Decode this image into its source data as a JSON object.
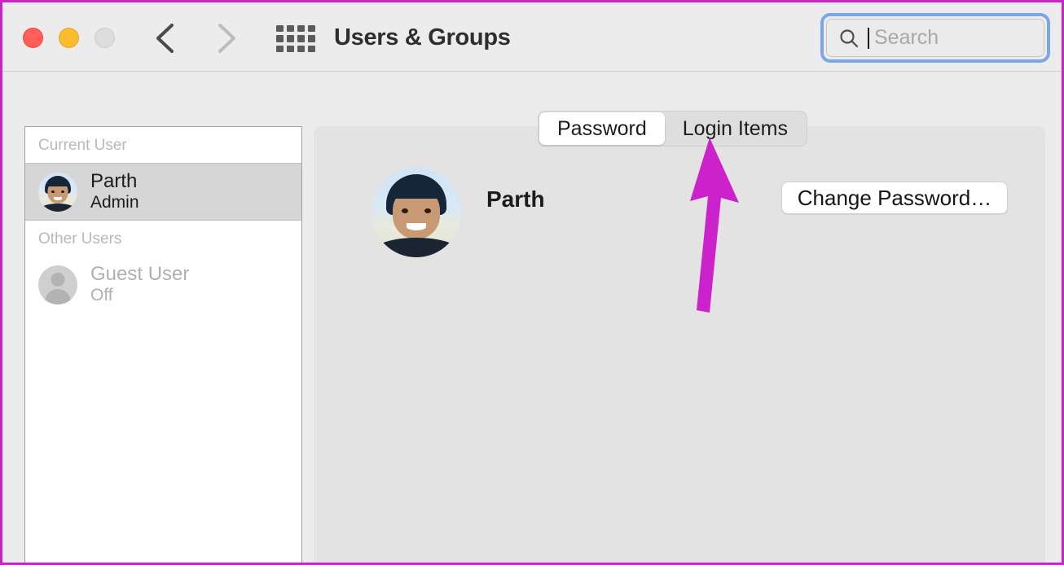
{
  "window": {
    "title": "Users & Groups",
    "traffic_lights": [
      "close-button",
      "minimize-button",
      "zoom-button"
    ],
    "back_icon": "chevron-left-icon",
    "forward_icon": "chevron-right-icon",
    "grid_icon": "show-all-grid-icon"
  },
  "search": {
    "placeholder": "Search",
    "value": "",
    "icon": "search-icon",
    "focused": true,
    "focus_ring_color": "#7aa7e8"
  },
  "sidebar": {
    "sections": [
      {
        "header": "Current User",
        "users": [
          {
            "name": "Parth",
            "role": "Admin",
            "selected": true,
            "avatar": "user-photo-avatar"
          }
        ]
      },
      {
        "header": "Other Users",
        "users": [
          {
            "name": "Guest User",
            "role": "Off",
            "selected": false,
            "avatar": "guest-person-icon"
          }
        ]
      }
    ]
  },
  "content": {
    "tabs": [
      {
        "label": "Password",
        "active": true
      },
      {
        "label": "Login Items",
        "active": false
      }
    ],
    "user": {
      "name": "Parth",
      "avatar": "user-photo-avatar"
    },
    "change_password_button": "Change Password…"
  },
  "annotation": {
    "arrow_color": "#cc22cc",
    "points_to": "Login Items",
    "border_color": "#cc22cc"
  }
}
